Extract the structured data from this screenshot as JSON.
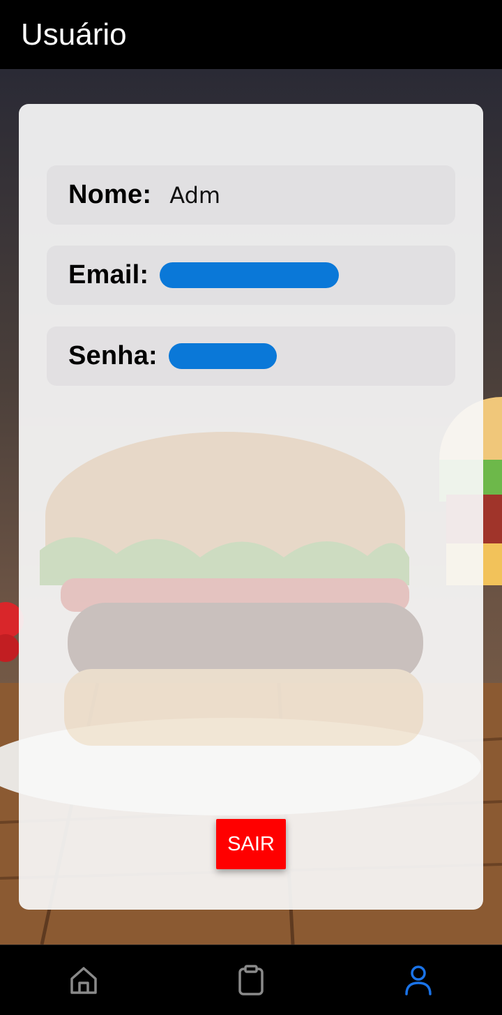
{
  "header": {
    "title": "Usuário"
  },
  "profile": {
    "name_label": "Nome:",
    "name_value": "Adm",
    "email_label": "Email:",
    "password_label": "Senha:"
  },
  "actions": {
    "logout_label": "SAIR"
  },
  "colors": {
    "header_bg": "#000000",
    "logout_button": "#ff0000",
    "redaction": "#0a78d8",
    "nav_active": "#1a73e8",
    "nav_inactive": "#8a8a8a"
  },
  "bottom_nav": [
    {
      "icon": "home-icon",
      "active": false
    },
    {
      "icon": "clipboard-icon",
      "active": false
    },
    {
      "icon": "user-icon",
      "active": true
    }
  ]
}
